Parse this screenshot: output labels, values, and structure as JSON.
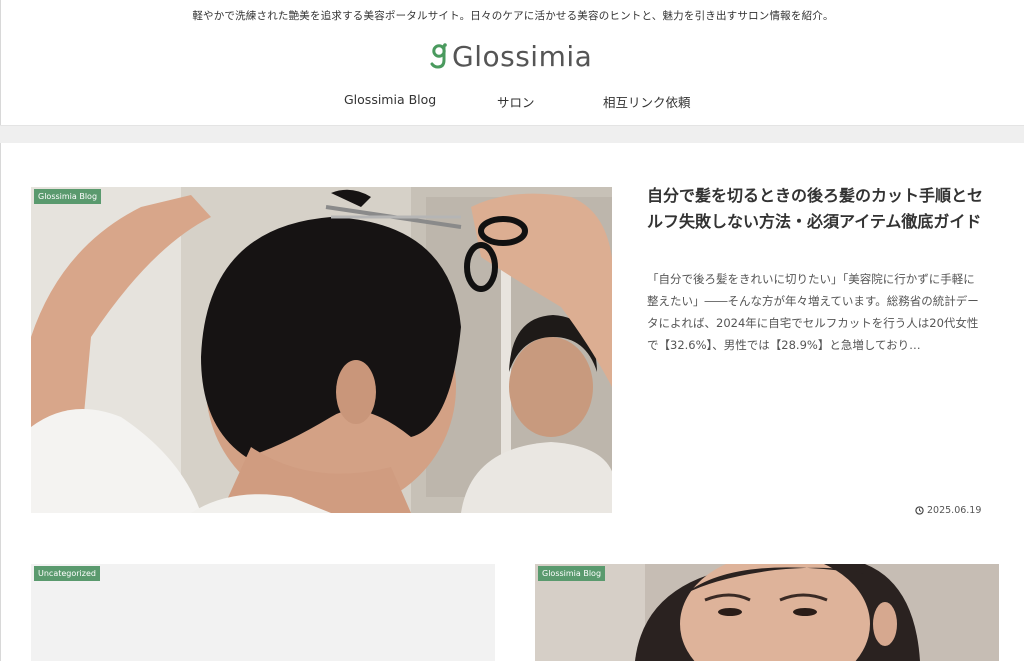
{
  "header": {
    "tagline": "軽やかで洗練された艶美を追求する美容ポータルサイト。日々のケアに活かせる美容のヒントと、魅力を引き出すサロン情報を紹介。",
    "logo_text": "Glossimia",
    "nav": [
      {
        "label": "Glossimia Blog"
      },
      {
        "label": "サロン"
      },
      {
        "label": "相互リンク依頼"
      }
    ]
  },
  "featured": {
    "category": "Glossimia Blog",
    "title": "自分で髪を切るときの後ろ髪のカット手順とセルフ失敗しない方法・必須アイテム徹底ガイド",
    "excerpt": "「自分で後ろ髪をきれいに切りたい」「美容院に行かずに手軽に整えたい」――そんな方が年々増えています。総務省の統計データによれば、2024年に自宅でセルフカットを行う人は20代女性で【32.6%】、男性では【28.9%】と急増しており…",
    "date": "2025.06.19"
  },
  "cards": [
    {
      "category": "Uncategorized"
    },
    {
      "category": "Glossimia Blog"
    }
  ],
  "colors": {
    "accent_green": "#5a9a6e",
    "logo_green": "#4a9a5e",
    "text": "#333333"
  },
  "icons": {
    "logo": "glossimia-g-logo-icon",
    "date": "clock-icon"
  }
}
